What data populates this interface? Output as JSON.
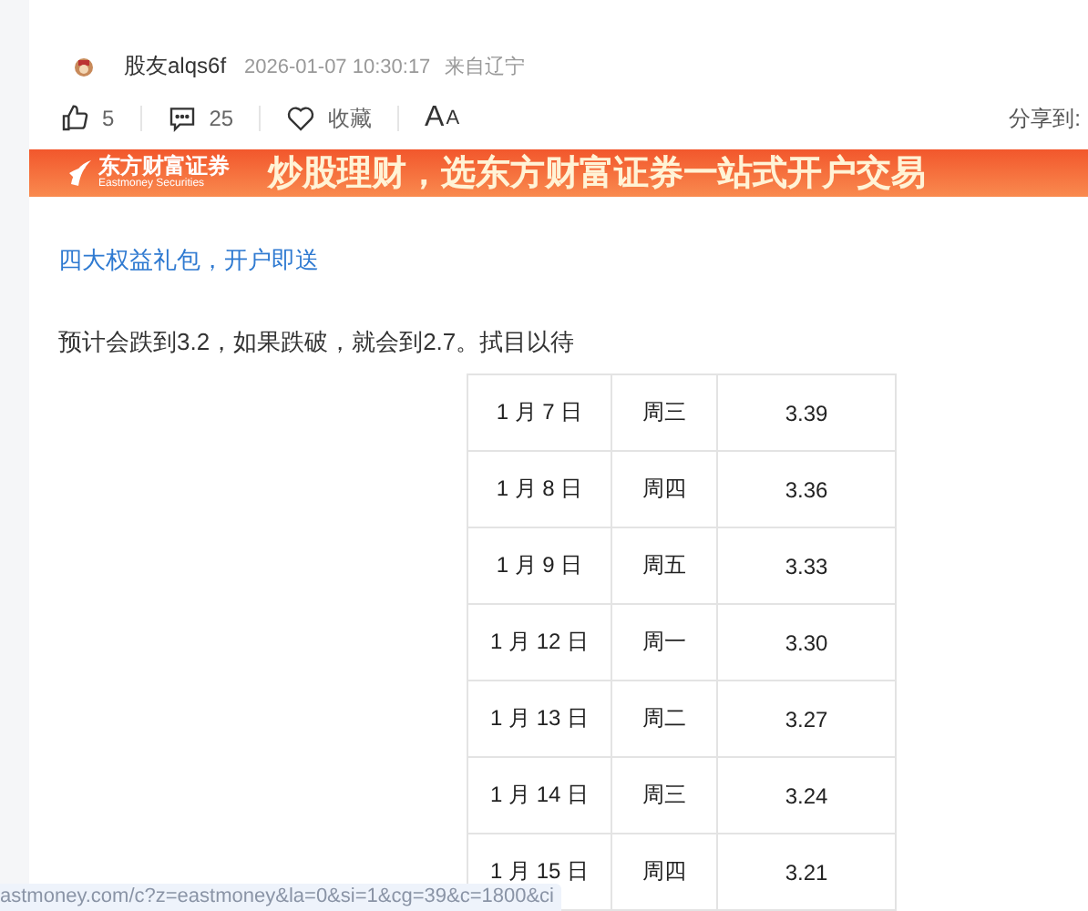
{
  "post": {
    "author": "股友alqs6f",
    "time": "2026-01-07 10:30:17",
    "location": "来自辽宁"
  },
  "actions": {
    "likes": "5",
    "comments": "25",
    "favorite": "收藏",
    "font_big": "A",
    "font_small": "A",
    "share": "分享到:"
  },
  "banner": {
    "brand": "东方财富证券",
    "brand_en": "Eastmoney Securities",
    "slogan": "炒股理财，选东方财富证券一站式开户交易"
  },
  "promo_link": "四大权益礼包，开户即送",
  "body": "预计会跌到3.2，如果跌破，就会到2.7。拭目以待",
  "table": {
    "rows": [
      [
        "1 月 7 日",
        "周三",
        "3.39"
      ],
      [
        "1 月 8 日",
        "周四",
        "3.36"
      ],
      [
        "1 月 9 日",
        "周五",
        "3.33"
      ],
      [
        "1 月 12 日",
        "周一",
        "3.30"
      ],
      [
        "1 月 13 日",
        "周二",
        "3.27"
      ],
      [
        "1 月 14 日",
        "周三",
        "3.24"
      ],
      [
        "1 月 15 日",
        "周四",
        "3.21"
      ]
    ]
  },
  "status_url": "astmoney.com/c?z=eastmoney&la=0&si=1&cg=39&c=1800&ci"
}
